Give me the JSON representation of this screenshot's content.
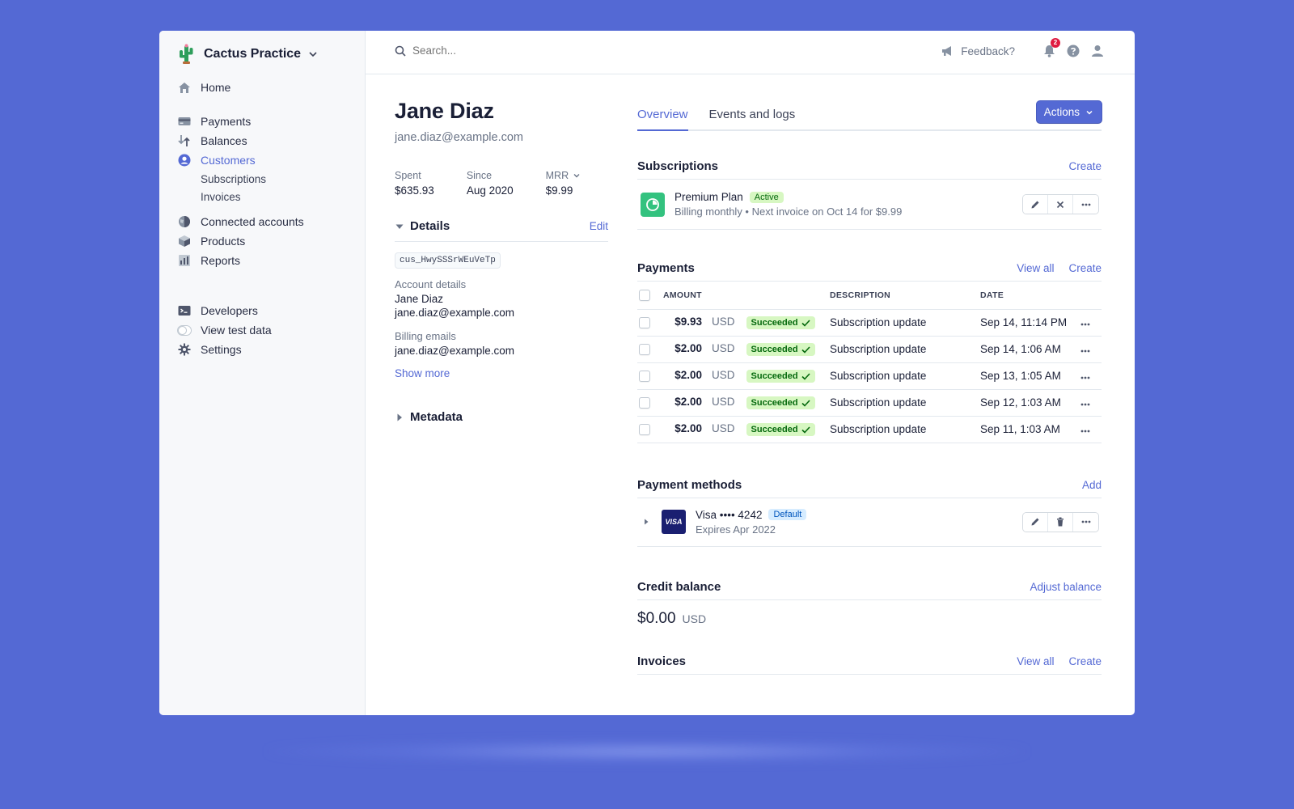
{
  "brand": {
    "name": "Cactus Practice",
    "icon": "cactus-icon"
  },
  "sidebar": {
    "items": [
      {
        "label": "Home",
        "icon": "home-icon"
      },
      {
        "label": "Payments",
        "icon": "payments-icon"
      },
      {
        "label": "Balances",
        "icon": "balances-icon"
      },
      {
        "label": "Customers",
        "icon": "customers-icon",
        "active": true
      },
      {
        "label": "Subscriptions"
      },
      {
        "label": "Invoices"
      },
      {
        "label": "Connected accounts",
        "icon": "globe-icon"
      },
      {
        "label": "Products",
        "icon": "box-icon"
      },
      {
        "label": "Reports",
        "icon": "reports-icon"
      },
      {
        "label": "Developers",
        "icon": "terminal-icon"
      },
      {
        "label": "View test data",
        "icon": "toggle-icon"
      },
      {
        "label": "Settings",
        "icon": "gear-icon"
      }
    ]
  },
  "topbar": {
    "search_placeholder": "Search...",
    "feedback_label": "Feedback?",
    "notification_count": "2"
  },
  "customer": {
    "name": "Jane Diaz",
    "email": "jane.diaz@example.com",
    "stats": [
      {
        "label": "Spent",
        "value": "$635.93"
      },
      {
        "label": "Since",
        "value": "Aug 2020"
      },
      {
        "label": "MRR",
        "value": "$9.99"
      }
    ],
    "details_title": "Details",
    "edit_label": "Edit",
    "id": "cus_HwySSSrWEuVeTp",
    "account_details_label": "Account details",
    "account_name": "Jane Diaz",
    "account_email": "jane.diaz@example.com",
    "billing_emails_label": "Billing emails",
    "billing_email": "jane.diaz@example.com",
    "show_more": "Show more",
    "metadata_title": "Metadata"
  },
  "tabs": [
    {
      "label": "Overview",
      "active": true
    },
    {
      "label": "Events and logs"
    }
  ],
  "actions_label": "Actions",
  "subscriptions": {
    "title": "Subscriptions",
    "create": "Create",
    "plan_name": "Premium Plan",
    "status": "Active",
    "detail": "Billing monthly • Next invoice on Oct 14 for $9.99"
  },
  "payments": {
    "title": "Payments",
    "view_all": "View all",
    "create": "Create",
    "columns": [
      "AMOUNT",
      "DESCRIPTION",
      "DATE"
    ],
    "rows": [
      {
        "amount": "$9.93",
        "currency": "USD",
        "status": "Succeeded",
        "description": "Subscription update",
        "date": "Sep 14, 11:14 PM"
      },
      {
        "amount": "$2.00",
        "currency": "USD",
        "status": "Succeeded",
        "description": "Subscription update",
        "date": "Sep 14, 1:06 AM"
      },
      {
        "amount": "$2.00",
        "currency": "USD",
        "status": "Succeeded",
        "description": "Subscription update",
        "date": "Sep 13, 1:05 AM"
      },
      {
        "amount": "$2.00",
        "currency": "USD",
        "status": "Succeeded",
        "description": "Subscription update",
        "date": "Sep 12, 1:03 AM"
      },
      {
        "amount": "$2.00",
        "currency": "USD",
        "status": "Succeeded",
        "description": "Subscription update",
        "date": "Sep 11, 1:03 AM"
      }
    ]
  },
  "payment_methods": {
    "title": "Payment methods",
    "add": "Add",
    "card_brand_logo": "VISA",
    "card_label": "Visa •••• 4242",
    "default_badge": "Default",
    "expires": "Expires Apr 2022"
  },
  "credit_balance": {
    "title": "Credit balance",
    "adjust": "Adjust balance",
    "amount": "$0.00",
    "currency": "USD"
  },
  "invoices": {
    "title": "Invoices",
    "view_all": "View all",
    "create": "Create"
  },
  "colors": {
    "background": "#5469d4",
    "accent": "#5469d4",
    "success_bg": "#d7f7c2",
    "success_text": "#05690d"
  }
}
